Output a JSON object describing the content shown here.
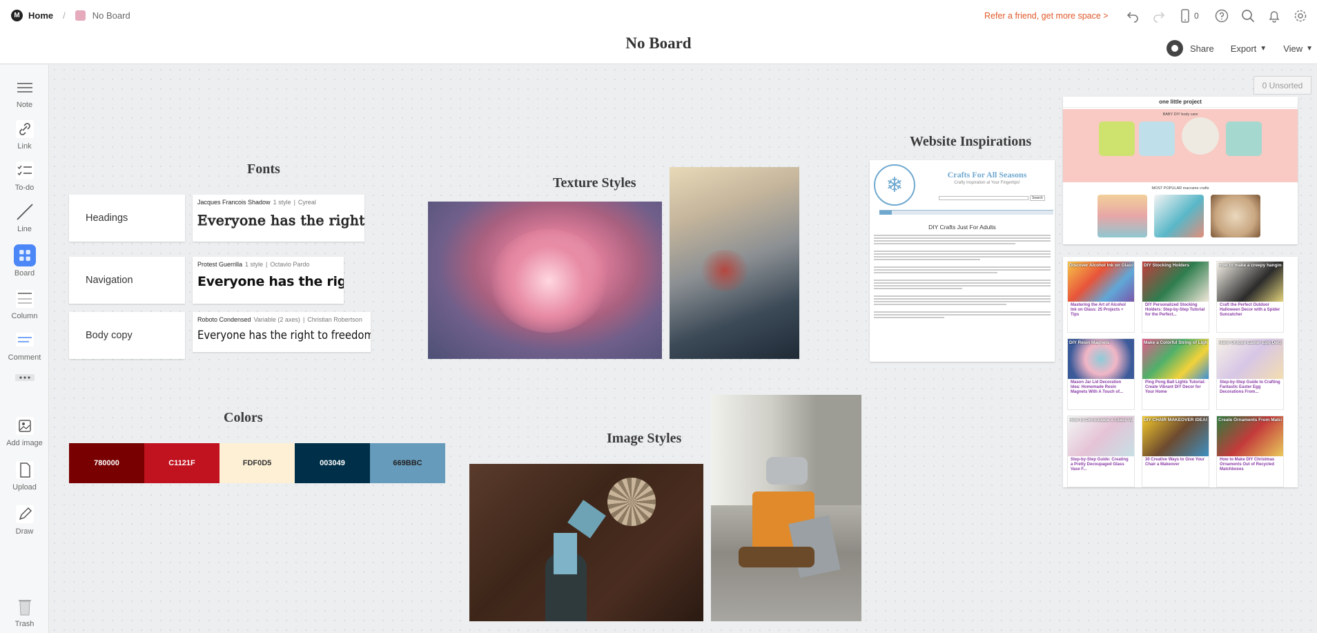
{
  "topbar": {
    "home_label": "Home",
    "board_label": "No Board",
    "title": "No Board",
    "refer": "Refer a friend, get more space >",
    "device_count": "0",
    "share": "Share",
    "export": "Export",
    "view": "View"
  },
  "sidebar": {
    "note": "Note",
    "link": "Link",
    "todo": "To-do",
    "line": "Line",
    "board": "Board",
    "column": "Column",
    "comment": "Comment",
    "add_image": "Add image",
    "upload": "Upload",
    "draw": "Draw",
    "trash": "Trash"
  },
  "canvas": {
    "unsorted": "0 Unsorted",
    "fonts_heading": "Fonts",
    "texture_heading": "Texture Styles",
    "colors_heading": "Colors",
    "image_heading": "Image Styles",
    "website_heading": "Website Inspirations",
    "font_rows": [
      {
        "label": "Headings",
        "font": "Jacques Francois Shadow",
        "styles": "1 style",
        "author": "Cyreal",
        "sample": "Everyone has the right"
      },
      {
        "label": "Navigation",
        "font": "Protest Guerrilla",
        "styles": "1 style",
        "author": "Octavio Pardo",
        "sample": "Everyone has the right"
      },
      {
        "label": "Body copy",
        "font": "Roboto Condensed",
        "styles": "Variable (2 axes)",
        "author": "Christian Robertson",
        "sample": "Everyone has the right to freedom"
      }
    ],
    "colors": [
      {
        "label": "780000",
        "hex": "#780000",
        "text": "#ffffff"
      },
      {
        "label": "C1121F",
        "hex": "#C1121F",
        "text": "#ffffff"
      },
      {
        "label": "FDF0D5",
        "hex": "#FDF0D5",
        "text": "#333333"
      },
      {
        "label": "003049",
        "hex": "#003049",
        "text": "#ffffff"
      },
      {
        "label": "669BBC",
        "hex": "#669BBC",
        "text": "#222222"
      }
    ],
    "crafts_site": {
      "title": "Crafts For All Seasons",
      "tagline": "Crafty Inspiration at Your Fingertips!",
      "search_button": "Search",
      "article_title": "DIY Crafts Just For Adults"
    },
    "onelittle_site": {
      "brand": "one little project",
      "section1": "BABY DIY body care",
      "section2": "MOST POPULAR macrame crafts"
    },
    "pins": [
      {
        "title": "Mastering the Art of Alcohol Ink on Glass: 25 Projects + Tips",
        "banner": "Discover Alcohol Ink on Glass"
      },
      {
        "title": "DIY Personalized Stocking Holders: Step-by-Step Tutorial for the Perfect...",
        "banner": "DIY Stocking Holders"
      },
      {
        "title": "Craft the Perfect Outdoor Halloween Decor with a Spider Suncatcher",
        "banner": "How to make a creepy hanging spider suncatcher"
      },
      {
        "title": "Mason Jar Lid Decoration Idea: Homemade Resin Magnets With A Touch of...",
        "banner": "DIY Resin Magnets"
      },
      {
        "title": "Ping Pong Ball Lights Tutorial: Create Vibrant DIY Decor for Your Home",
        "banner": "Make a Colorful String of Lights"
      },
      {
        "title": "Step-by-Step Guide to Crafting Fantastic Easter Egg Decorations From...",
        "banner": "Make Unique Easter Egg Decorations"
      },
      {
        "title": "Step-by-Step Guide: Creating a Pretty Decoupaged Glass Vase F...",
        "banner": "How to Decoupage a Glass Vase"
      },
      {
        "title": "30 Creative Ways to Give Your Chair a Makeover",
        "banner": "DIY CHAIR MAKEOVER IDEAS"
      },
      {
        "title": "How to Make DIY Christmas Ornaments Out of Recycled Matchboxes",
        "banner": "Create Ornaments From Matchboxes"
      }
    ]
  }
}
